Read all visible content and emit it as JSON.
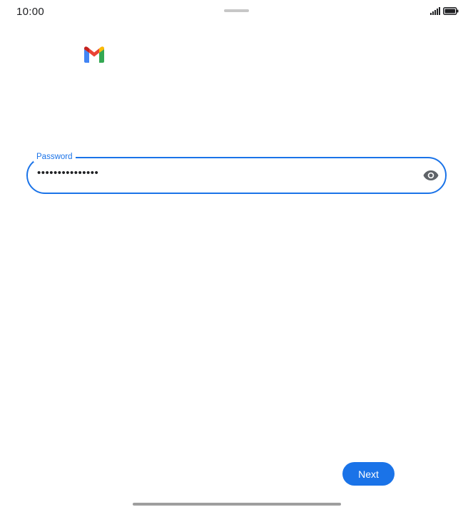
{
  "status_bar": {
    "time": "10:00",
    "signal_icon": "signal-icon",
    "battery_icon": "battery-icon"
  },
  "logo": {
    "icon": "gmail-logo-icon"
  },
  "password_field": {
    "label": "Password",
    "value": "•••••••••••••••",
    "toggle_icon": "eye-icon"
  },
  "actions": {
    "next_label": "Next"
  },
  "colors": {
    "accent": "#1a73e8",
    "text": "#202124"
  }
}
